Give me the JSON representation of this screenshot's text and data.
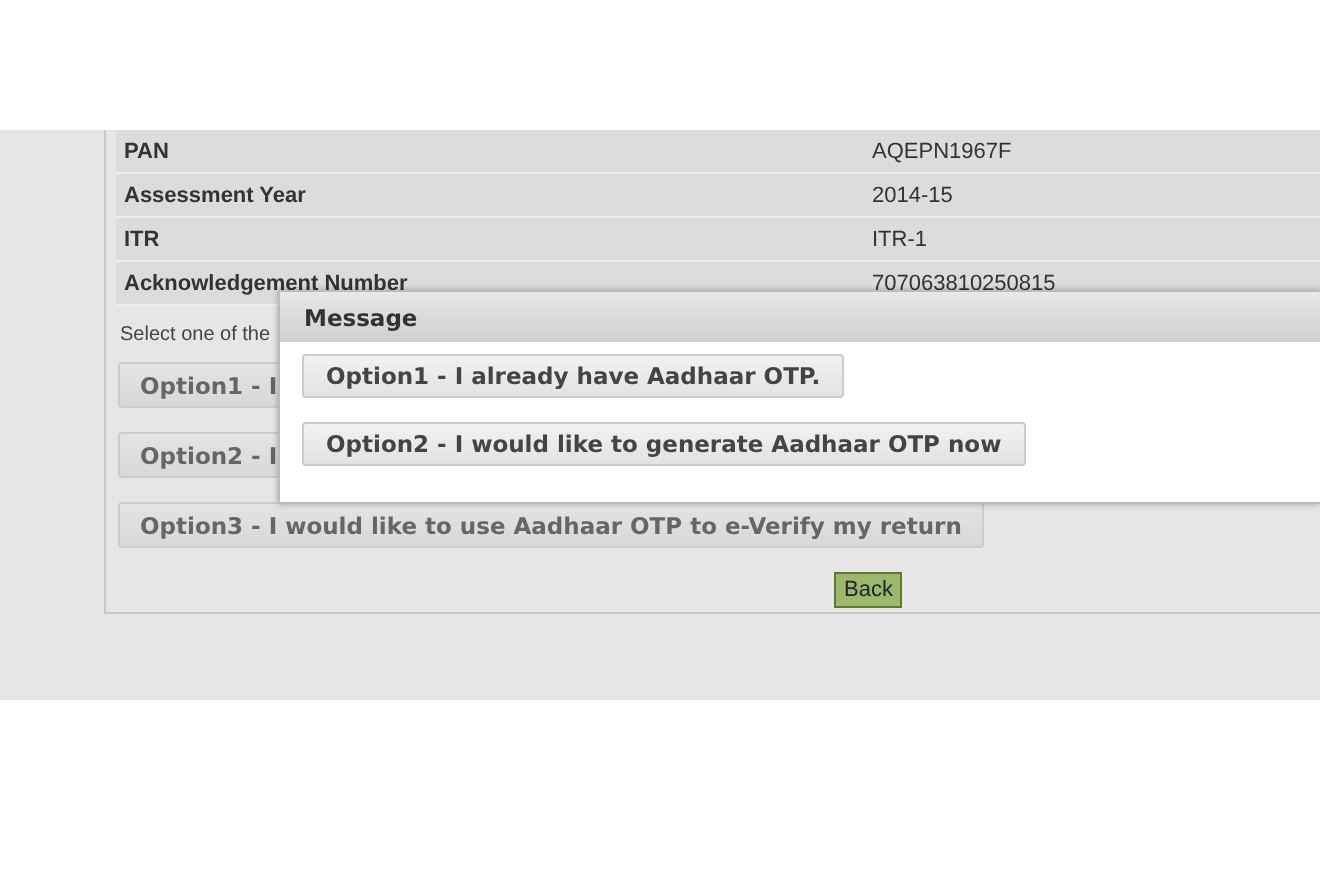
{
  "details": [
    {
      "label": "PAN",
      "value": "AQEPN1967F"
    },
    {
      "label": "Assessment Year",
      "value": "2014-15"
    },
    {
      "label": "ITR",
      "value": "ITR-1"
    },
    {
      "label": "Acknowledgement Number",
      "value": "707063810250815"
    }
  ],
  "instruction": "Select one of the",
  "options": [
    "Option1 - I",
    "Option2 - I",
    "Option3 - I would like to use Aadhaar OTP to e-Verify my return"
  ],
  "back_button": "Back",
  "dialog": {
    "title": "Message",
    "options": [
      "Option1 - I already have Aadhaar OTP.",
      "Option2 - I would like to generate Aadhaar OTP now"
    ]
  }
}
